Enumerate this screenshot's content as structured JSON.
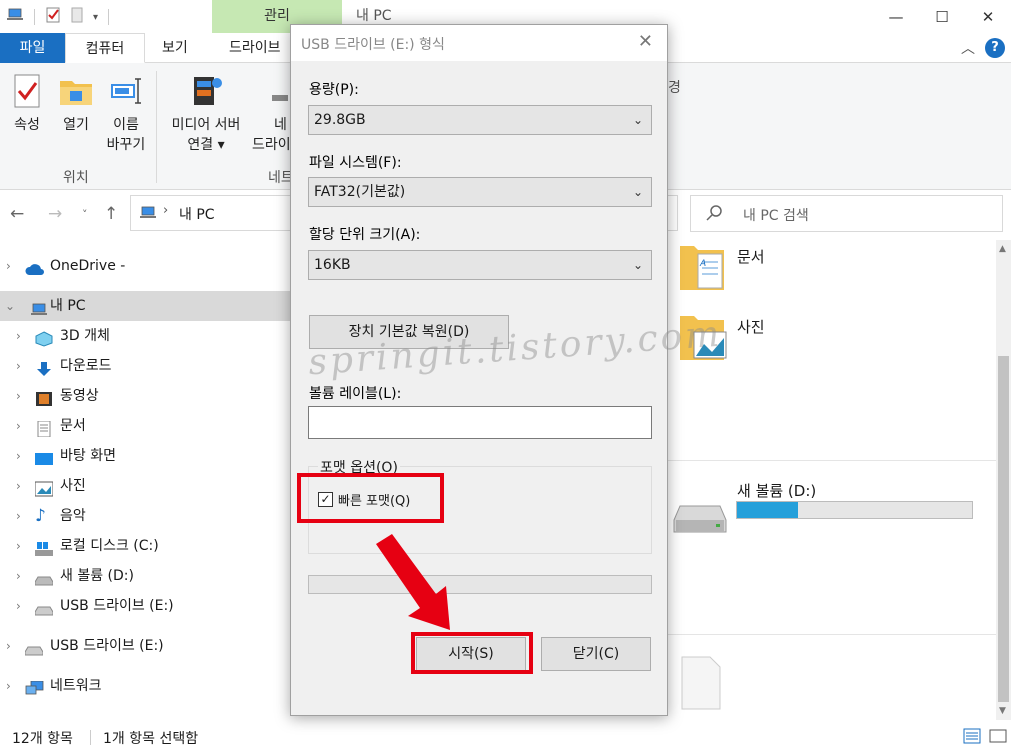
{
  "window": {
    "manage_tab": "관리",
    "title": "내 PC",
    "minimize": "—",
    "maximize": "☐",
    "close": "✕"
  },
  "tabs": {
    "file": "파일",
    "computer": "컴퓨터",
    "view": "보기",
    "drive_tools": "드라이브"
  },
  "ribbon": {
    "properties": "속성",
    "open": "열기",
    "rename_line1": "이름",
    "rename_line2": "바꾸기",
    "media_server_line1": "미디어 서버",
    "media_server_line2": "연결",
    "network_line1": "네",
    "network_line2": "드라이",
    "group_location": "위치",
    "group_network": "네트",
    "right_partial": "경"
  },
  "address": {
    "path_item": "내 PC",
    "search_placeholder": "내 PC 검색"
  },
  "nav_tree": [
    {
      "label": "OneDrive -",
      "icon": "cloud-icon",
      "level": 0
    },
    {
      "label": "내 PC",
      "icon": "pc-icon",
      "level": 0,
      "selected": true,
      "expanded": true
    },
    {
      "label": "3D 개체",
      "icon": "cube-icon",
      "level": 1
    },
    {
      "label": "다운로드",
      "icon": "download-icon",
      "level": 1
    },
    {
      "label": "동영상",
      "icon": "video-icon",
      "level": 1
    },
    {
      "label": "문서",
      "icon": "document-icon",
      "level": 1
    },
    {
      "label": "바탕 화면",
      "icon": "desktop-icon",
      "level": 1
    },
    {
      "label": "사진",
      "icon": "picture-icon",
      "level": 1
    },
    {
      "label": "음악",
      "icon": "music-icon",
      "level": 1
    },
    {
      "label": "로컬 디스크 (C:)",
      "icon": "windows-drive-icon",
      "level": 1
    },
    {
      "label": "새 볼륨 (D:)",
      "icon": "drive-icon",
      "level": 1
    },
    {
      "label": "USB 드라이브 (E:)",
      "icon": "usb-drive-icon",
      "level": 1
    },
    {
      "label": "USB 드라이브 (E:)",
      "icon": "usb-drive-icon",
      "level": 0
    },
    {
      "label": "네트워크",
      "icon": "network-icon",
      "level": 0
    }
  ],
  "content": {
    "folder_documents": "문서",
    "folder_pictures": "사진",
    "volume_d": "새 볼륨 (D:)",
    "volume_d_usage": 0.26
  },
  "status": {
    "item_count": "12개 항목",
    "selected": "1개 항목 선택함"
  },
  "dialog": {
    "title": "USB 드라이브 (E:) 형식",
    "capacity_label": "용량(P):",
    "capacity_value": "29.8GB",
    "filesystem_label": "파일 시스템(F):",
    "filesystem_value": "FAT32(기본값)",
    "alloc_label": "할당 단위 크기(A):",
    "alloc_value": "16KB",
    "restore_defaults": "장치 기본값 복원(D)",
    "volume_label": "볼륨 레이블(L):",
    "volume_value": "",
    "format_options": "포맷 옵션(O)",
    "quick_format": "빠른 포맷(Q)",
    "quick_format_checked": true,
    "progress": 0,
    "start_button": "시작(S)",
    "close_button": "닫기(C)"
  },
  "watermark": "springit.tistory.com",
  "colors": {
    "accent": "#1a6fc2",
    "manage_tab": "#c6e8b3",
    "annotation": "#e60012",
    "drive_fill": "#26a0da"
  }
}
